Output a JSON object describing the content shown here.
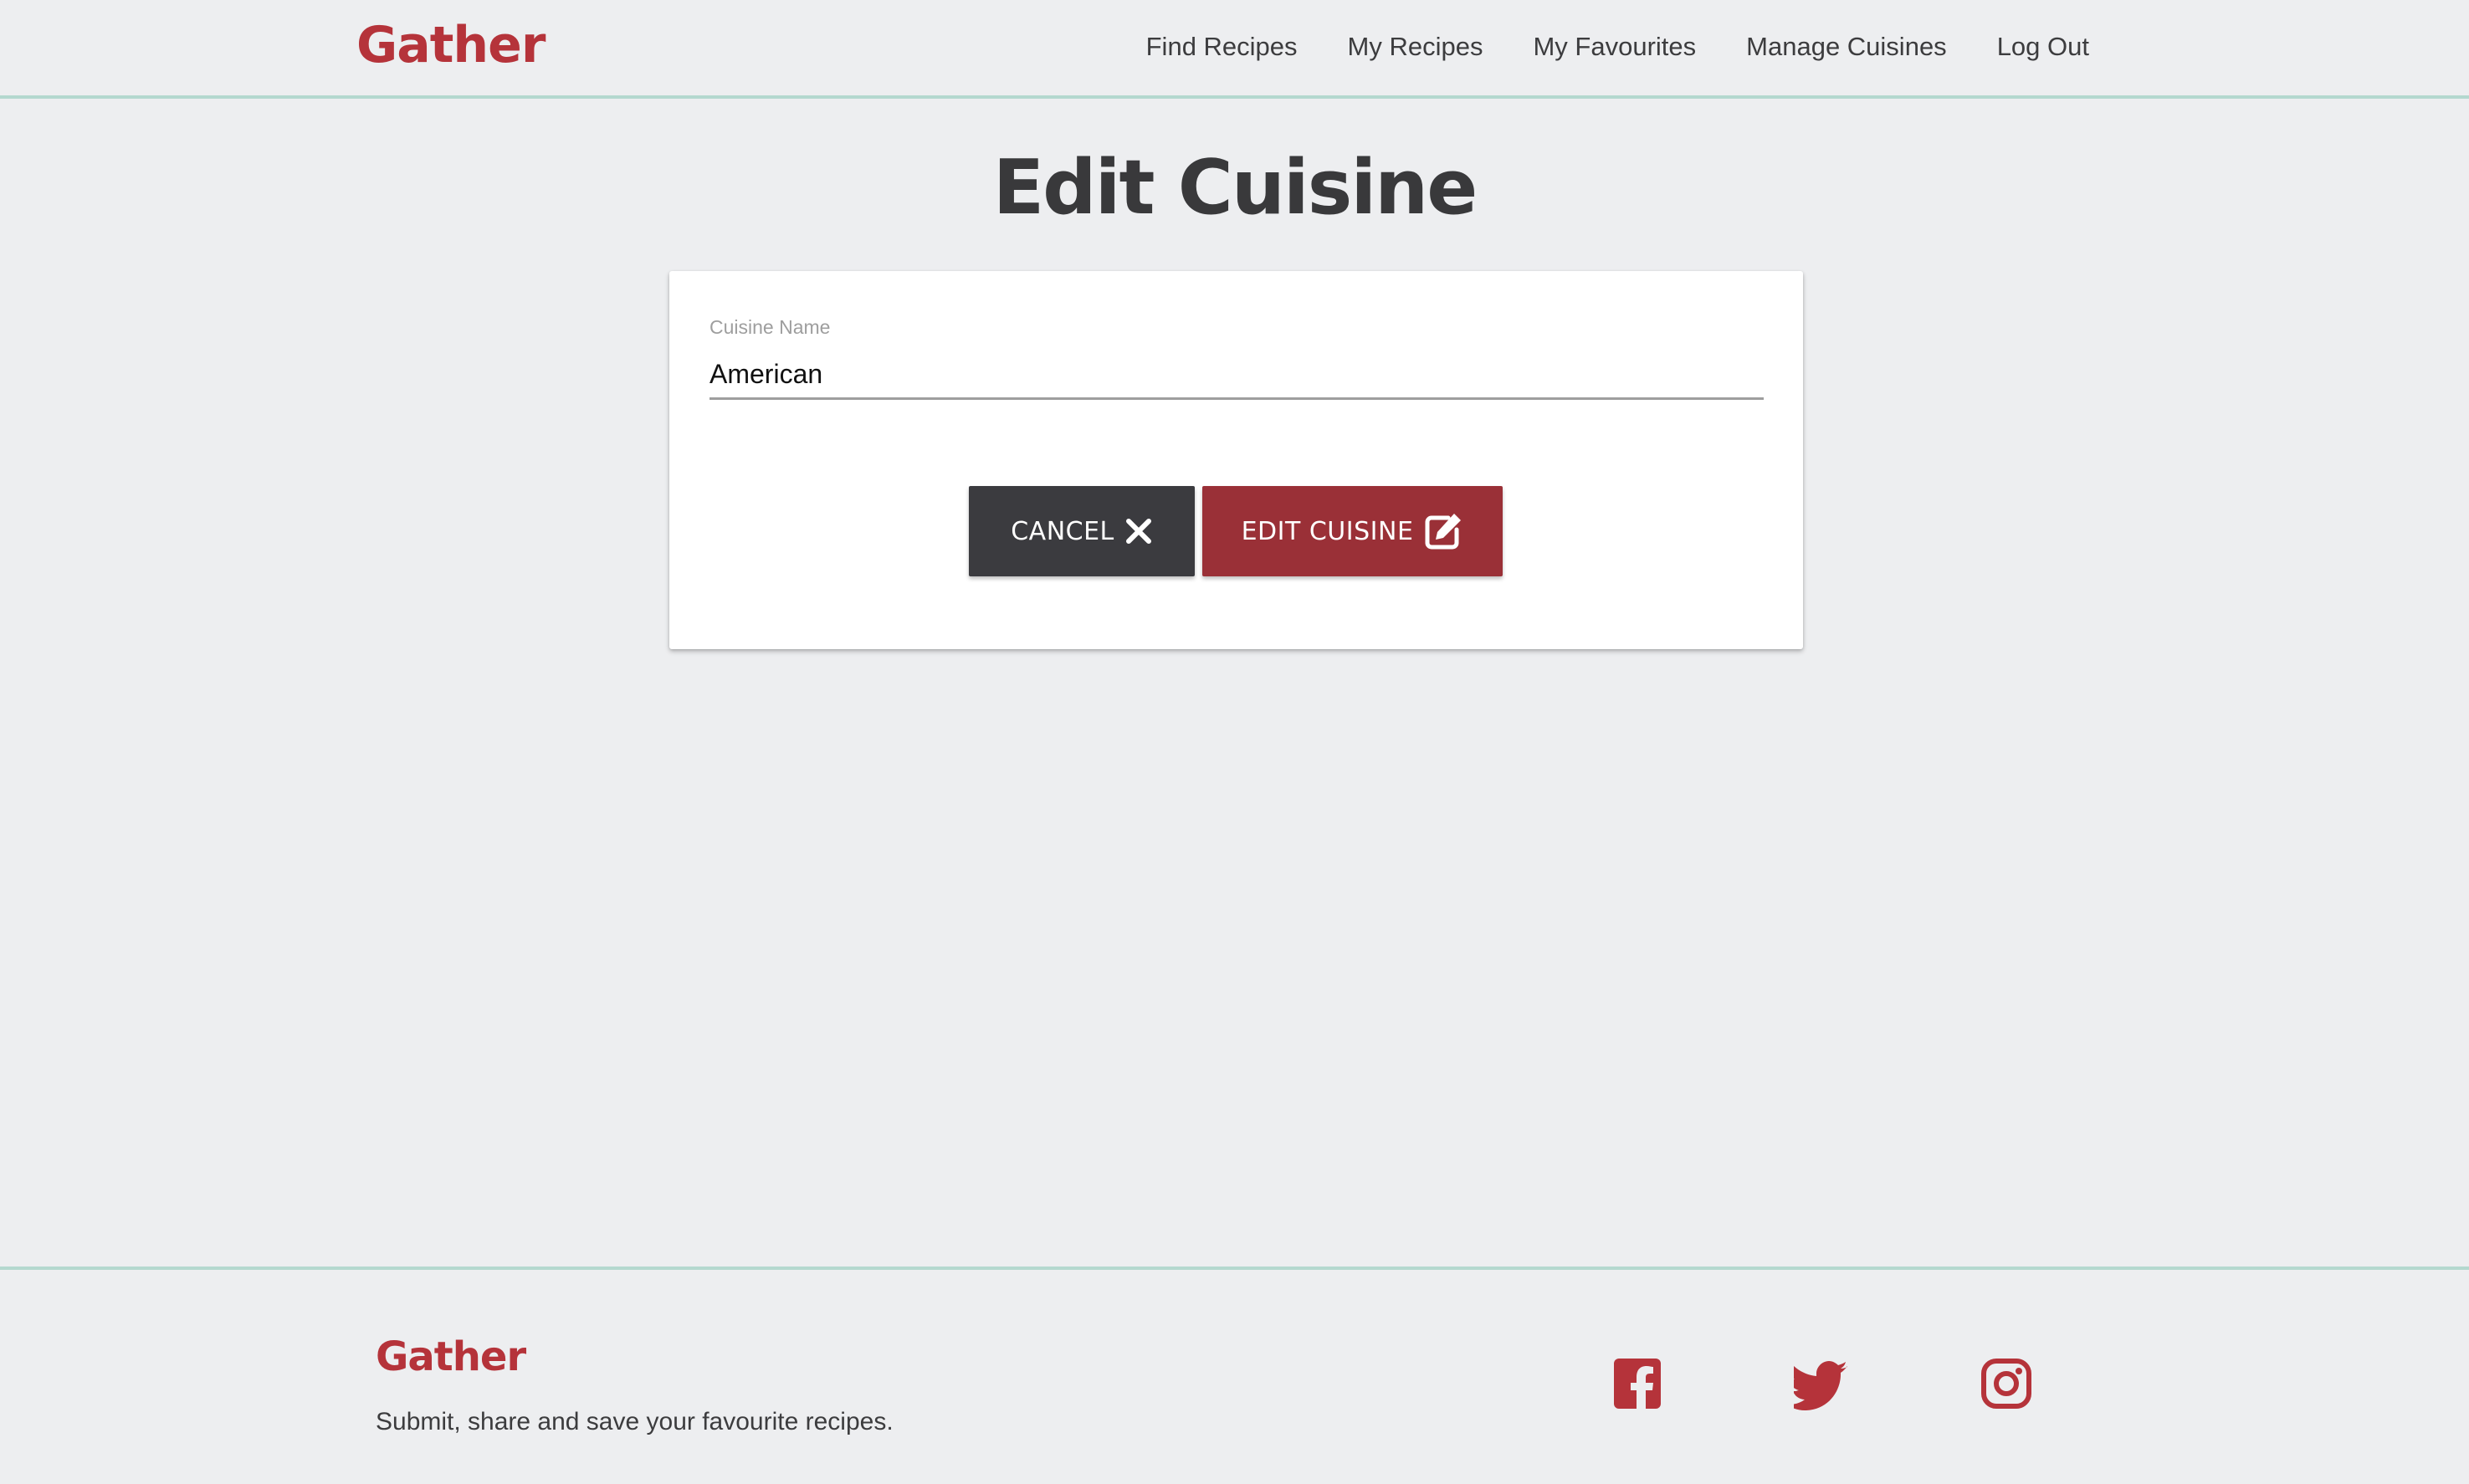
{
  "header": {
    "brand": "Gather",
    "nav": [
      {
        "label": "Find Recipes"
      },
      {
        "label": "My Recipes"
      },
      {
        "label": "My Favourites"
      },
      {
        "label": "Manage Cuisines"
      },
      {
        "label": "Log Out"
      }
    ]
  },
  "main": {
    "title": "Edit Cuisine",
    "form": {
      "cuisine_label": "Cuisine Name",
      "cuisine_value": "American",
      "cancel_label": "CANCEL",
      "cancel_icon": "close-icon",
      "submit_label": "EDIT CUISINE",
      "submit_icon": "edit-icon"
    }
  },
  "footer": {
    "brand": "Gather",
    "tagline": "Submit, share and save your favourite recipes.",
    "social": [
      "facebook-icon",
      "twitter-icon",
      "instagram-icon"
    ]
  },
  "colors": {
    "brand": "#b5333a",
    "cancel_button": "#3b3b3f",
    "submit_button": "#9a3037",
    "divider": "#b4d8cf",
    "background": "#edeef0"
  }
}
